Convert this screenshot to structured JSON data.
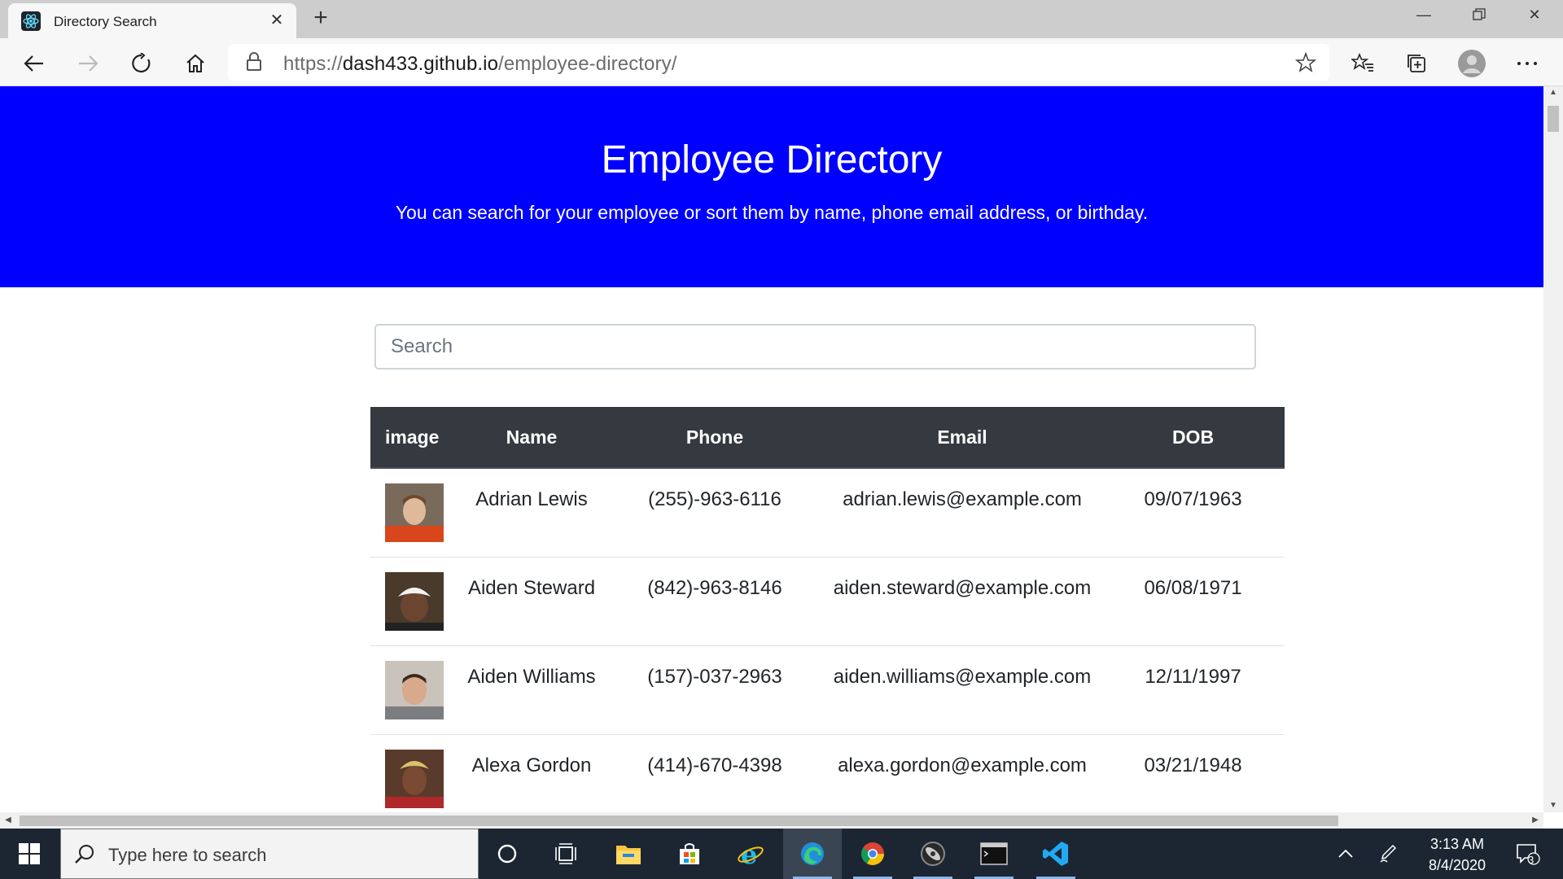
{
  "browser": {
    "tab_title": "Directory Search",
    "url_scheme": "https://",
    "url_host": "dash433.github.io",
    "url_path": "/employee-directory/"
  },
  "page": {
    "title": "Employee Directory",
    "subtitle": "You can search for your employee or sort them by name, phone email address, or birthday.",
    "search_placeholder": "Search",
    "header_color": "#0000ff"
  },
  "table": {
    "columns": [
      "image",
      "Name",
      "Phone",
      "Email",
      "DOB"
    ],
    "rows": [
      {
        "name": "Adrian Lewis",
        "phone": "(255)-963-6116",
        "email": "adrian.lewis@example.com",
        "dob": "09/07/1963"
      },
      {
        "name": "Aiden Steward",
        "phone": "(842)-963-8146",
        "email": "aiden.steward@example.com",
        "dob": "06/08/1971"
      },
      {
        "name": "Aiden Williams",
        "phone": "(157)-037-2963",
        "email": "aiden.williams@example.com",
        "dob": "12/11/1997"
      },
      {
        "name": "Alexa Gordon",
        "phone": "(414)-670-4398",
        "email": "alexa.gordon@example.com",
        "dob": "03/21/1948"
      }
    ]
  },
  "taskbar": {
    "search_placeholder": "Type here to search",
    "time": "3:13 AM",
    "date": "8/4/2020",
    "notification_count": "3"
  }
}
